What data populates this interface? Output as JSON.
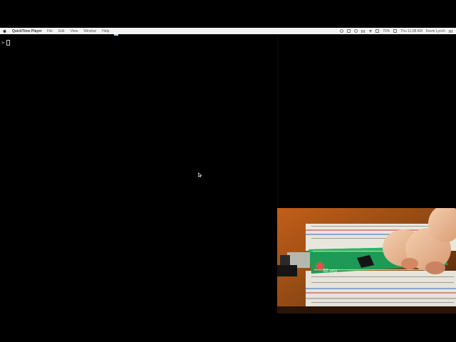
{
  "menubar": {
    "apple_icon": "apple-logo-icon",
    "app_name": "QuickTime Player",
    "menus": [
      "File",
      "Edit",
      "View",
      "Window",
      "Help"
    ],
    "status_icons": [
      "status-icon-1",
      "status-icon-2",
      "status-icon-3",
      "status-icon-4",
      "wifi-icon",
      "volume-icon",
      "battery-icon"
    ],
    "battery_text": "70%",
    "clock": "Thu 11:08 AM",
    "user_name": "Kevin Lynch",
    "menu_extra_icon": "notification-center-icon",
    "background": "#f3f3f4"
  },
  "terminal": {
    "prompt": ">",
    "cursor_icon": "text-cursor",
    "text_color": "#d8d8d8"
  },
  "pointer": {
    "icon": "mouse-pointer-icon"
  },
  "camera": {
    "description_label": "",
    "board_text": "32.org",
    "accent_colors": {
      "board_green": "#1d9a55",
      "breadboard": "#e9e7dd",
      "led_red": "#ff3b3b",
      "skin": "#f0c4a2",
      "background": "#7a4216"
    }
  }
}
